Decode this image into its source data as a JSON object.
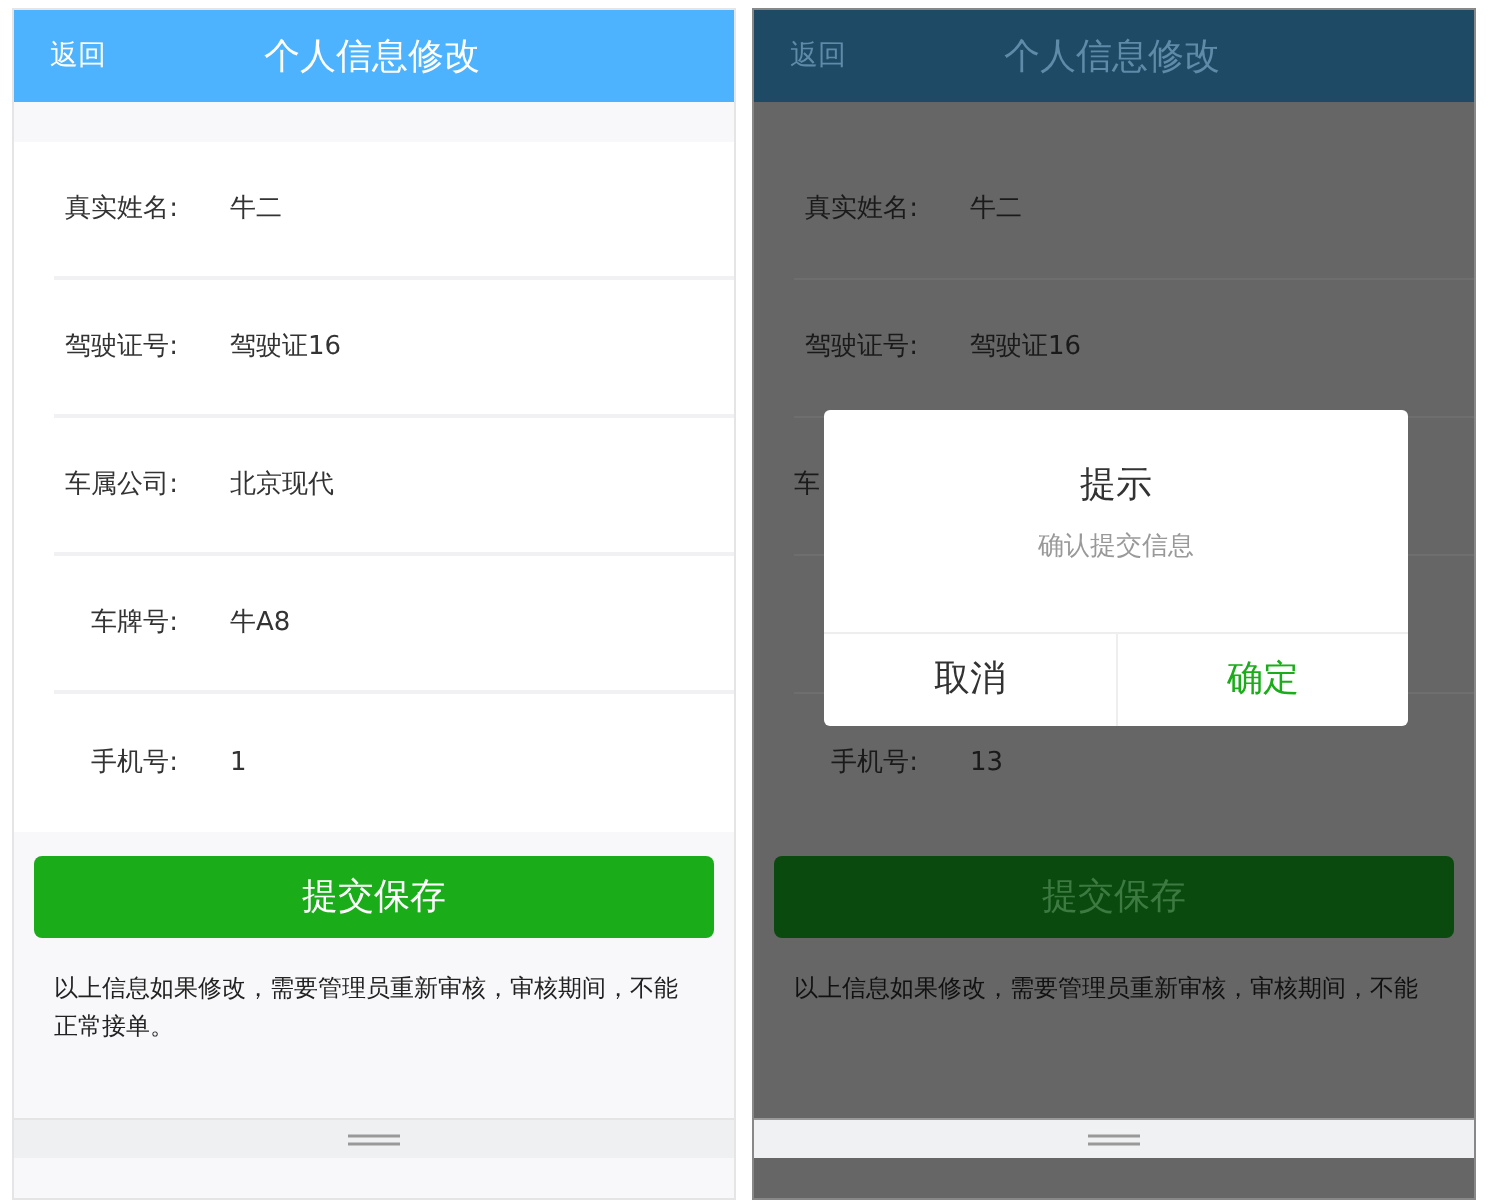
{
  "screens": [
    {
      "dimmed": false,
      "header": {
        "back": "返回",
        "title": "个人信息修改"
      },
      "rows": [
        {
          "label": "真实姓名:",
          "value": "牛二"
        },
        {
          "label": "驾驶证号:",
          "value": "驾驶证16"
        },
        {
          "label": "车属公司:",
          "value": "北京现代"
        },
        {
          "label": "车牌号:",
          "value": "牛A8"
        },
        {
          "label": "手机号:",
          "value": "1"
        }
      ],
      "submit": "提交保存",
      "note": "以上信息如果修改，需要管理员重新审核，审核期间，不能正常接单。"
    },
    {
      "dimmed": true,
      "header": {
        "back": "返回",
        "title": "个人信息修改"
      },
      "rows": [
        {
          "label": "真实姓名:",
          "value": "牛二"
        },
        {
          "label": "驾驶证号:",
          "value": "驾驶证16"
        },
        {
          "label": "车"
        },
        {},
        {
          "label": "手机号:",
          "value": "13"
        }
      ],
      "submit": "提交保存",
      "note": "以上信息如果修改，需要管理员重新审核，审核期间，不能",
      "dialog": {
        "title": "提示",
        "message": "确认提交信息",
        "cancel": "取消",
        "confirm": "确定"
      }
    }
  ]
}
